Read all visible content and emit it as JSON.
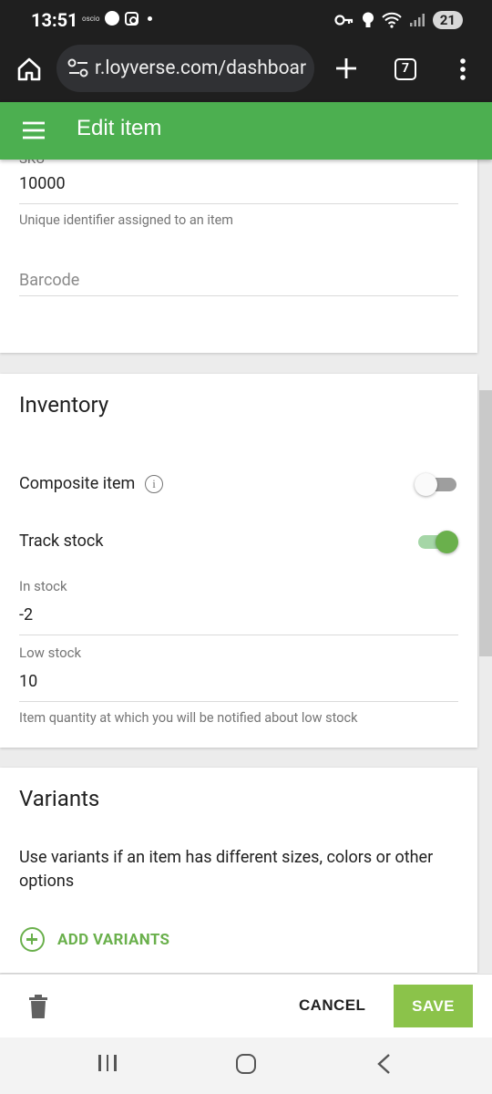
{
  "status_bar": {
    "time": "13:51",
    "carrier_label": "oscio",
    "battery": "21",
    "icons": [
      "facebook-icon",
      "instagram-icon",
      "key-icon",
      "bulb-icon",
      "wifi-icon",
      "signal-icon"
    ]
  },
  "browser": {
    "url": "r.loyverse.com/dashboard",
    "tab_count": "7"
  },
  "header": {
    "title": "Edit item",
    "color": "#4caf50"
  },
  "sku_card": {
    "sku_label": "SKU",
    "sku_value": "10000",
    "sku_helper": "Unique identifier assigned to an item",
    "barcode_placeholder": "Barcode"
  },
  "inventory": {
    "title": "Inventory",
    "composite_label": "Composite item",
    "composite_enabled": false,
    "track_stock_label": "Track stock",
    "track_stock_enabled": true,
    "in_stock_label": "In stock",
    "in_stock_value": "-2",
    "low_stock_label": "Low stock",
    "low_stock_value": "10",
    "low_stock_helper": "Item quantity at which you will be notified about low stock"
  },
  "variants": {
    "title": "Variants",
    "description": "Use variants if an item has different sizes, colors or other options",
    "add_label": "ADD VARIANTS"
  },
  "actions": {
    "cancel_label": "CANCEL",
    "save_label": "SAVE",
    "accent": "#8bc34a"
  }
}
